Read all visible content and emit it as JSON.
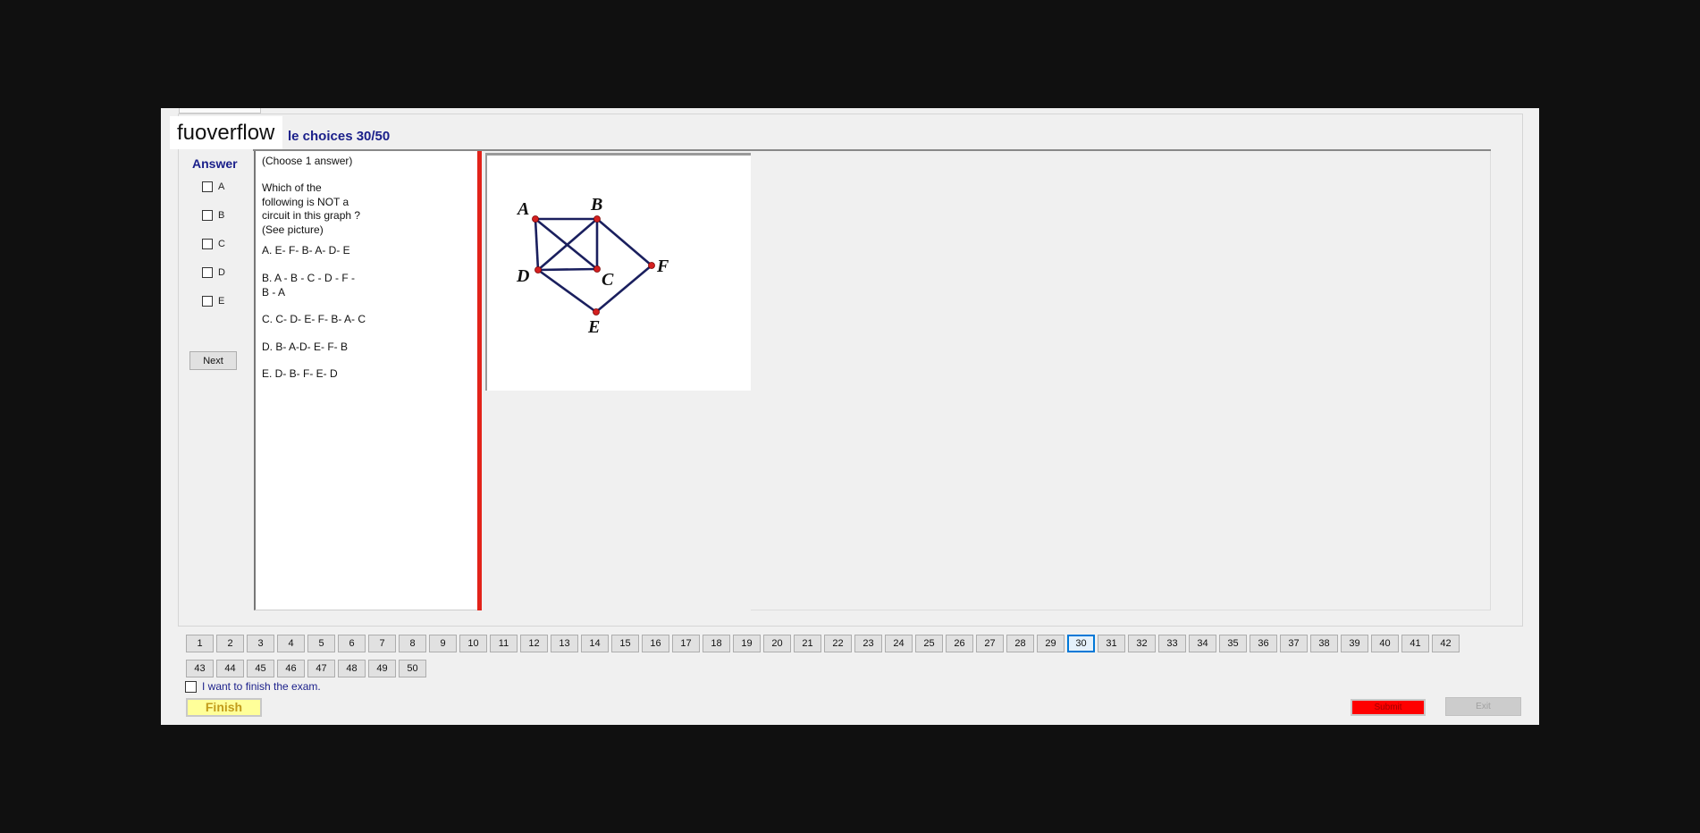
{
  "app": {
    "watermark": "fuoverflow",
    "title": "le choices 30/50"
  },
  "answer_panel": {
    "label": "Answer",
    "options": [
      "A",
      "B",
      "C",
      "D",
      "E"
    ],
    "next_label": "Next"
  },
  "question": {
    "instruction": "(Choose 1 answer)",
    "text": "Which of the\nfollowing is NOT a\ncircuit in this graph ?\n(See picture)",
    "choices": [
      "A.  E- F- B- A- D- E",
      "B.  A - B - C - D - F -\nB - A",
      "C.  C- D- E- F- B- A- C",
      "D.  B- A-D- E- F- B",
      "E.  D- B- F- E- D"
    ]
  },
  "graph": {
    "vertices": [
      "A",
      "B",
      "C",
      "D",
      "E",
      "F"
    ],
    "edges": [
      [
        "A",
        "B"
      ],
      [
        "A",
        "C"
      ],
      [
        "A",
        "D"
      ],
      [
        "B",
        "C"
      ],
      [
        "B",
        "D"
      ],
      [
        "B",
        "F"
      ],
      [
        "C",
        "D"
      ],
      [
        "D",
        "E"
      ],
      [
        "E",
        "F"
      ]
    ],
    "edge_color": "#1a1f5e",
    "vertex_color": "#d42020"
  },
  "navigation": {
    "questions": [
      1,
      2,
      3,
      4,
      5,
      6,
      7,
      8,
      9,
      10,
      11,
      12,
      13,
      14,
      15,
      16,
      17,
      18,
      19,
      20,
      21,
      22,
      23,
      24,
      25,
      26,
      27,
      28,
      29,
      30,
      31,
      32,
      33,
      34,
      35,
      36,
      37,
      38,
      39,
      40,
      41,
      42,
      43,
      44,
      45,
      46,
      47,
      48,
      49,
      50
    ],
    "current": 30
  },
  "footer": {
    "finish_check_label": "I want to finish the exam.",
    "finish_label": "Finish",
    "submit_label": "Submit",
    "exit_label": "Exit"
  },
  "colors": {
    "accent": "#1a1f8a",
    "submit": "#ff0000",
    "finish": "#ffff99",
    "separator": "#e2231a"
  }
}
